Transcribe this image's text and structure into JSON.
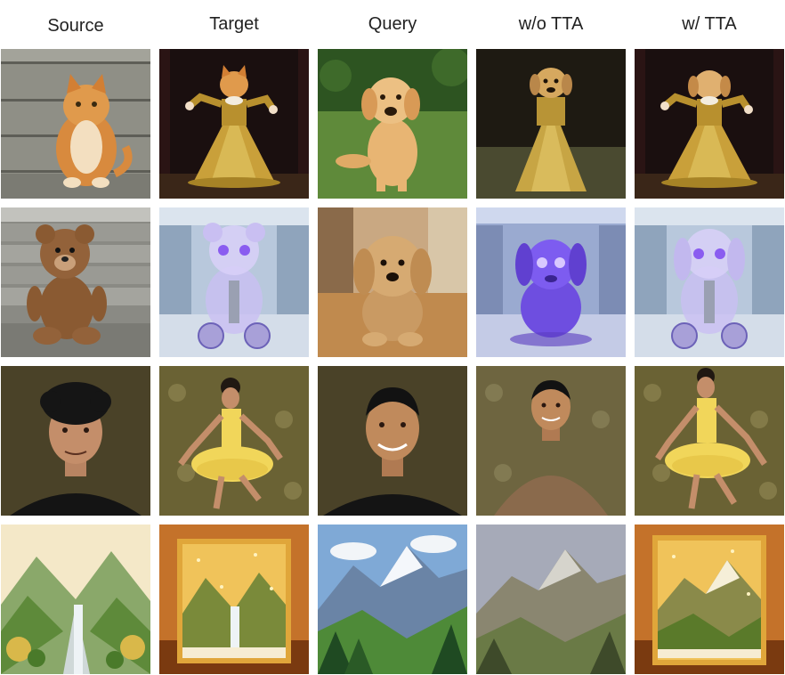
{
  "headers": [
    "Source",
    "Target",
    "Query",
    "w/o TTA",
    "w/ TTA"
  ],
  "rows": [
    {
      "subject": "cat-dog-dress",
      "cells": [
        "orange tabby cat sitting on stone steps",
        "cat in golden gown on dark stage",
        "golden retriever puppy sitting on grass",
        "dog in golden dress on stage (w/o TTA)",
        "dog in golden gown on dark stage (w/ TTA)"
      ]
    },
    {
      "subject": "teddy-robot",
      "cells": [
        "brown teddy bear on wooden bench",
        "transparent robot bear in lab",
        "plush puppy toy on wooden table",
        "purple glowing robot dog in lab (w/o TTA)",
        "transparent robot dog in lab (w/ TTA)"
      ]
    },
    {
      "subject": "man-ballet",
      "cells": [
        "curly-haired man in black t-shirt portrait",
        "man in yellow tutu dancing",
        "smiling man in black t-shirt portrait",
        "man in brown sweater portrait (w/o TTA)",
        "man in yellow tutu dancing (w/ TTA)"
      ]
    },
    {
      "subject": "landscape-resin",
      "cells": [
        "watercolor waterfall valley painting",
        "waterfall scene in glitter resin block",
        "snowy mountain valley painting",
        "muted mountain valley painting (w/o TTA)",
        "mountain scene in glitter resin block (w/ TTA)"
      ]
    }
  ],
  "colors": {
    "cat_orange": "#d88a3e",
    "gold": "#c9a03a",
    "dark_stage": "#1a0f0f",
    "grass": "#5f8a3a",
    "lab_blue": "#b8c8dc",
    "robot_purple": "#8a5cf0",
    "plush_tan": "#c99a63",
    "portrait_bg": "#4a4228",
    "tutu_yellow": "#f1d65a",
    "resin_amber": "#e0a63a",
    "sky_blue": "#7fa9d6"
  }
}
